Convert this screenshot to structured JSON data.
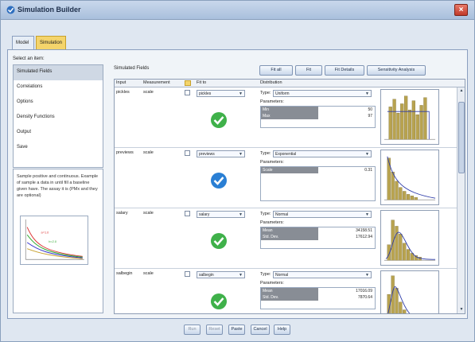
{
  "window": {
    "title": "Simulation Builder",
    "close_icon": "close-icon"
  },
  "tabs": [
    {
      "label": "Model"
    },
    {
      "label": "Simulation"
    }
  ],
  "left": {
    "select_label": "Select an item:",
    "items": [
      {
        "label": "Simulated Fields"
      },
      {
        "label": "Correlations"
      },
      {
        "label": "Options"
      },
      {
        "label": "Density Functions"
      },
      {
        "label": "Output"
      },
      {
        "label": "Save"
      }
    ],
    "description": "Sample positive and continuous. Example of sample a data in until fill a baseline given have. The assay it is (PMx and they are optional)"
  },
  "main": {
    "simulated_label": "Simulated Fields",
    "toolbar": [
      "Fit all",
      "Fit",
      "Fit Details",
      "Sensitivity Analysis"
    ],
    "columns": [
      "Input",
      "Measurement",
      "",
      "Fit to",
      "Distribution"
    ],
    "rows": [
      {
        "input": "pickles",
        "measure": "scale",
        "fit_to": "pickles",
        "status": "check-green",
        "type": "Uniform",
        "params_label": "Parameters:",
        "params": [
          {
            "name": "Min",
            "value": "50"
          },
          {
            "name": "Max",
            "value": "97"
          }
        ]
      },
      {
        "input": "previews",
        "measure": "scale",
        "fit_to": "previews",
        "status": "check-blue",
        "type": "Exponential",
        "params_label": "Parameters:",
        "params": [
          {
            "name": "Scale",
            "value": "0.31"
          }
        ]
      },
      {
        "input": "salary",
        "measure": "scale",
        "fit_to": "salary",
        "status": "check-green",
        "type": "Normal",
        "params_label": "Parameters:",
        "params": [
          {
            "name": "Mean",
            "value": "34158.51"
          },
          {
            "name": "Std. Dev.",
            "value": "17612.94"
          }
        ]
      },
      {
        "input": "salbegin",
        "measure": "scale",
        "fit_to": "salbegin",
        "status": "check-green",
        "type": "Normal",
        "params_label": "Parameters:",
        "params": [
          {
            "name": "Mean",
            "value": "17016.09"
          },
          {
            "name": "Std. Dev.",
            "value": "7870.64"
          }
        ]
      }
    ]
  },
  "bottom_buttons": [
    "Run",
    "Reset",
    "Paste",
    "Cancel",
    "Help"
  ],
  "colors": {
    "accent": "#f4d46b",
    "check_green": "#3fb14a",
    "check_blue": "#2a7fd4",
    "hist_bar": "#b8a34f",
    "curve": "#2c3aa8"
  }
}
